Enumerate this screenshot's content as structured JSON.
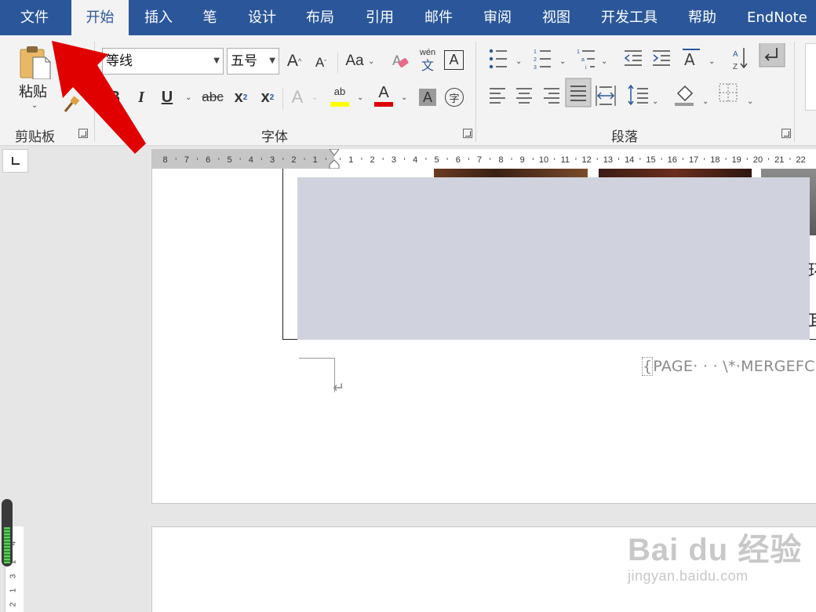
{
  "tabs": [
    "文件",
    "开始",
    "插入",
    "笔",
    "设计",
    "布局",
    "引用",
    "邮件",
    "审阅",
    "视图",
    "开发工具",
    "帮助",
    "EndNote X"
  ],
  "active_tab": "开始",
  "ribbon": {
    "clipboard": {
      "paste_label": "粘贴",
      "group_label": "剪贴板"
    },
    "font": {
      "font_name": "等线",
      "font_size": "五号",
      "grow_font": "A",
      "shrink_font": "A",
      "change_case": "Aa",
      "bold": "B",
      "italic": "I",
      "underline": "U",
      "strikethrough": "abc",
      "subscript": "x",
      "superscript": "x",
      "text_effects": "A",
      "highlight": "ab",
      "font_color": "A",
      "char_shading": "A",
      "enclose_char": "字",
      "phonetic_top": "wén",
      "phonetic_bottom": "文",
      "char_border": "A",
      "group_label": "字体"
    },
    "paragraph": {
      "group_label": "段落"
    }
  },
  "ruler": {
    "left_numbers": [
      "8",
      "7",
      "6",
      "5",
      "4",
      "3",
      "2",
      "1"
    ],
    "right_numbers": [
      "1",
      "2",
      "3",
      "4",
      "5",
      "6",
      "7",
      "8",
      "9",
      "10",
      "11",
      "12",
      "13",
      "14",
      "15",
      "16",
      "17",
      "18",
      "19",
      "20",
      "21",
      "22"
    ]
  },
  "vertical_ruler": [
    "4",
    "1",
    "3",
    "1",
    "2"
  ],
  "document": {
    "edge_char_top": "环",
    "edge_char_bottom": "耳",
    "field_code": "PAGE· · · \\*·MERGEFC",
    "field_brace": "{",
    "paragraph_mark": "↵"
  },
  "watermark": {
    "logo": "Bai du 经验",
    "sub": "jingyan.baidu.com"
  },
  "colors": {
    "tab_bar": "#2b579a",
    "highlight_yellow": "#ffff00",
    "font_color_red": "#e00000",
    "arrow_red": "#e00000"
  }
}
